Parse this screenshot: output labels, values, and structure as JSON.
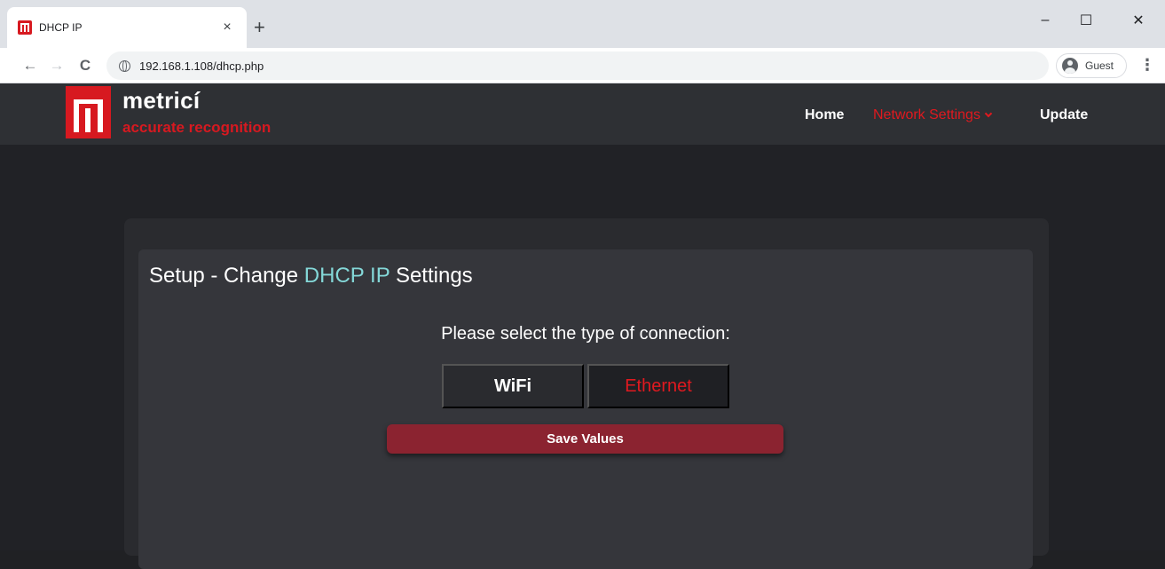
{
  "browser": {
    "tab_title": "DHCP IP",
    "tab_close": "×",
    "new_tab": "+",
    "url": "192.168.1.108/dhcp.php",
    "profile_label": "Guest",
    "menu_glyph": "⋮",
    "back_glyph": "←",
    "forward_glyph": "→",
    "reload_glyph": "C",
    "minimize_glyph": "–",
    "maximize_glyph": "☐",
    "close_glyph": "✕"
  },
  "site": {
    "brand": "metricí",
    "tagline": "accurate recognition",
    "nav": {
      "home": "Home",
      "network_settings": "Network Settings",
      "update": "Update"
    }
  },
  "card": {
    "title_prefix": "Setup - Change ",
    "title_highlight": "DHCP IP",
    "title_suffix": " Settings",
    "prompt": "Please select the type of connection:",
    "options": {
      "wifi": "WiFi",
      "ethernet": "Ethernet"
    },
    "selected_option": "Ethernet",
    "save_label": "Save Values"
  },
  "colors": {
    "accent_red": "#e0191f",
    "highlight_teal": "#84d8d8",
    "save_button": "#8b2330"
  },
  "icons": {
    "favicon": "metrici-favicon-icon",
    "site_info": "globe-icon",
    "profile": "avatar-icon",
    "dropdown": "chevron-down-icon"
  }
}
